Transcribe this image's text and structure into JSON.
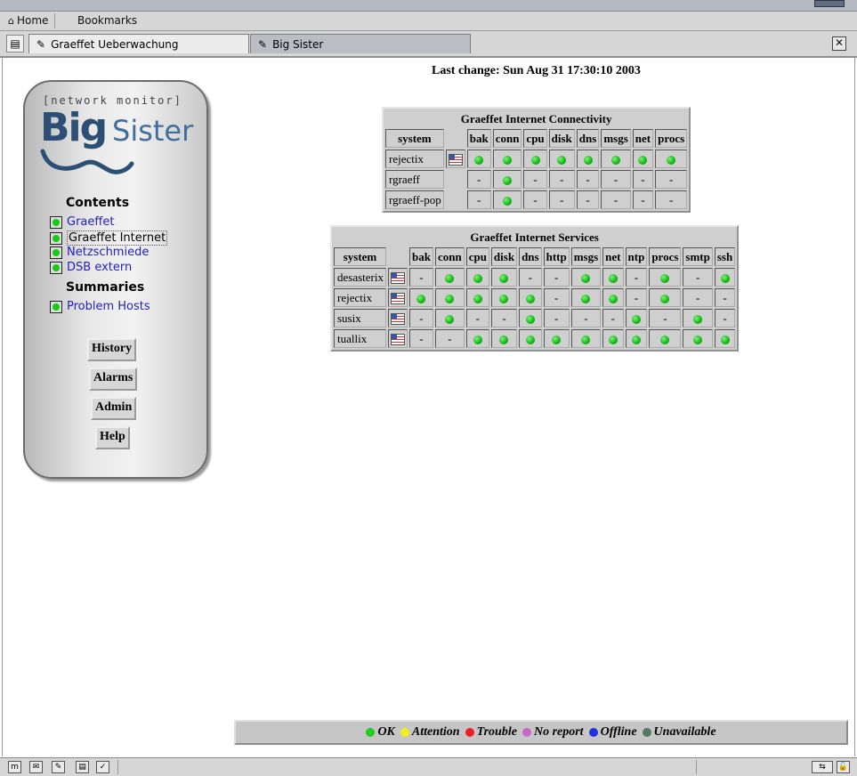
{
  "bookmarks_bar": {
    "home_label": "Home",
    "bookmarks_label": "Bookmarks"
  },
  "tabs": [
    {
      "label": "Graeffet Ueberwachung",
      "active": true
    },
    {
      "label": "Big Sister",
      "active": false
    }
  ],
  "sidebar": {
    "logo_tagline": "[network monitor]",
    "logo_big": "Big",
    "logo_sister": "Sister",
    "contents_heading": "Contents",
    "contents": [
      {
        "label": "Graeffet",
        "status": "green"
      },
      {
        "label": "Graeffet Internet",
        "status": "green",
        "current": true
      },
      {
        "label": "Netzschmiede",
        "status": "green"
      },
      {
        "label": "DSB extern",
        "status": "green"
      }
    ],
    "summaries_heading": "Summaries",
    "summaries": [
      {
        "label": "Problem Hosts",
        "status": "green"
      }
    ],
    "buttons": [
      "History",
      "Alarms",
      "Admin",
      "Help"
    ]
  },
  "last_change": "Last change: Sun Aug 31 17:30:10 2003",
  "tables": [
    {
      "title": "Graeffet Internet Connectivity",
      "columns": [
        "system",
        "",
        "bak",
        "conn",
        "cpu",
        "disk",
        "dns",
        "msgs",
        "net",
        "procs"
      ],
      "rows": [
        {
          "system": "rejectix",
          "history": true,
          "cells": [
            "ok",
            "ok",
            "ok",
            "ok",
            "ok",
            "ok",
            "ok",
            "ok"
          ]
        },
        {
          "system": "rgraeff",
          "history": false,
          "cells": [
            "-",
            "ok",
            "-",
            "-",
            "-",
            "-",
            "-",
            "-"
          ]
        },
        {
          "system": "rgraeff-pop",
          "history": false,
          "cells": [
            "-",
            "ok",
            "-",
            "-",
            "-",
            "-",
            "-",
            "-"
          ]
        }
      ]
    },
    {
      "title": "Graeffet Internet Services",
      "columns": [
        "system",
        "",
        "bak",
        "conn",
        "cpu",
        "disk",
        "dns",
        "http",
        "msgs",
        "net",
        "ntp",
        "procs",
        "smtp",
        "ssh"
      ],
      "rows": [
        {
          "system": "desasterix",
          "history": true,
          "cells": [
            "-",
            "ok",
            "ok",
            "ok",
            "-",
            "-",
            "ok",
            "ok",
            "-",
            "ok",
            "-",
            "ok"
          ]
        },
        {
          "system": "rejectix",
          "history": true,
          "cells": [
            "ok",
            "ok",
            "ok",
            "ok",
            "ok",
            "-",
            "ok",
            "ok",
            "-",
            "ok",
            "-",
            "-"
          ]
        },
        {
          "system": "susix",
          "history": true,
          "cells": [
            "-",
            "ok",
            "-",
            "-",
            "ok",
            "-",
            "-",
            "-",
            "ok",
            "-",
            "ok",
            "-"
          ]
        },
        {
          "system": "tuallix",
          "history": true,
          "cells": [
            "-",
            "-",
            "ok",
            "ok",
            "ok",
            "ok",
            "ok",
            "ok",
            "ok",
            "ok",
            "ok",
            "ok"
          ]
        }
      ]
    }
  ],
  "legend": [
    {
      "label": "OK",
      "color": "#22cc22"
    },
    {
      "label": "Attention",
      "color": "#eeee22"
    },
    {
      "label": "Trouble",
      "color": "#ee2222"
    },
    {
      "label": "No report",
      "color": "#cc66cc"
    },
    {
      "label": "Offline",
      "color": "#2233dd"
    },
    {
      "label": "Unavailable",
      "color": "#557766"
    }
  ]
}
